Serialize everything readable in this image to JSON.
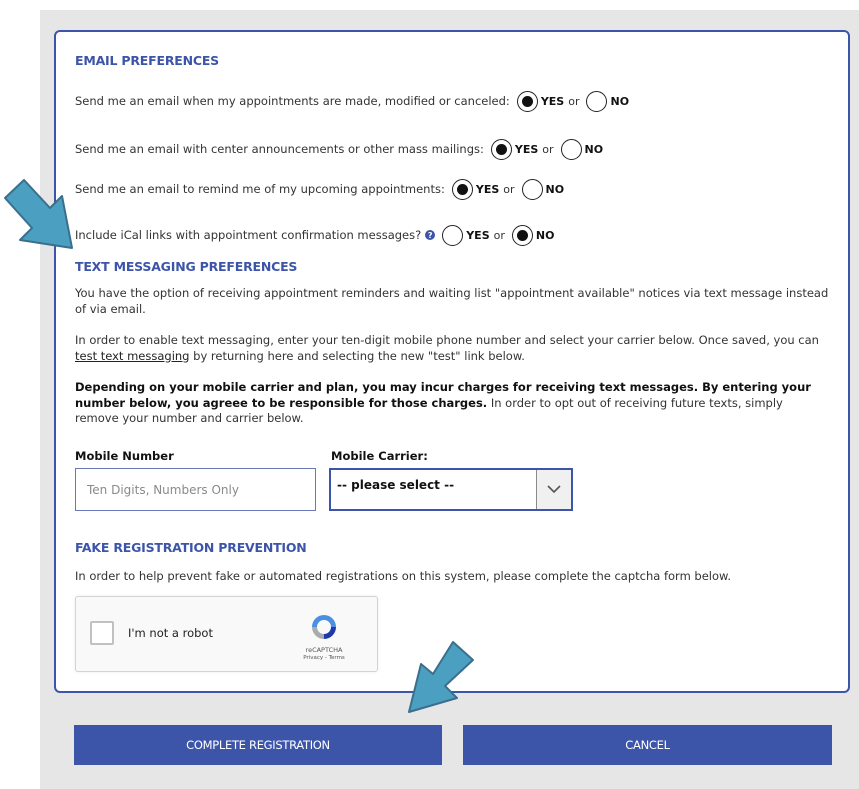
{
  "email_preferences": {
    "title": "EMAIL PREFERENCES",
    "yes_label": "YES",
    "no_label": "NO",
    "or_label": "or",
    "questions": [
      {
        "text": "Send me an email when my appointments are made, modified or canceled:",
        "selected": "YES"
      },
      {
        "text": "Send me an email with center announcements or other mass mailings:",
        "selected": "YES"
      },
      {
        "text": "Send me an email to remind me of my upcoming appointments:",
        "selected": "YES"
      },
      {
        "text": "Include iCal links with appointment confirmation messages?",
        "selected": "NO",
        "has_help_icon": true
      }
    ]
  },
  "text_messaging": {
    "title": "TEXT MESSAGING PREFERENCES",
    "para1": "You have the option of receiving appointment reminders and waiting list \"appointment available\" notices via text message instead of via email.",
    "para2_before": "In order to enable text messaging, enter your ten-digit mobile phone number and select your carrier below. Once saved, you can ",
    "para2_link": "test text messaging",
    "para2_after": " by returning here and selecting the new \"test\" link below.",
    "para3_bold": "Depending on your mobile carrier and plan, you may incur charges for receiving text messages. By entering your number below, you agreee to be responsible for those charges.",
    "para3_rest": " In order to opt out of receiving future texts, simply remove your number and carrier below.",
    "mobile_number_label": "Mobile Number",
    "mobile_number_placeholder": "Ten Digits, Numbers Only",
    "mobile_number_value": "",
    "mobile_carrier_label": "Mobile Carrier:",
    "mobile_carrier_selected": "-- please select --"
  },
  "fake_registration": {
    "title": "FAKE REGISTRATION PREVENTION",
    "description": "In order to help prevent fake or automated registrations on this system, please complete the captcha form below.",
    "captcha_label": "I'm not a robot",
    "captcha_brand": "reCAPTCHA",
    "captcha_links": "Privacy - Terms"
  },
  "actions": {
    "complete_label": "COMPLETE REGISTRATION",
    "cancel_label": "CANCEL"
  },
  "colors": {
    "accent": "#3d55a8",
    "annotation_arrow": "#4b9fc0",
    "background": "#e6e6e6"
  }
}
